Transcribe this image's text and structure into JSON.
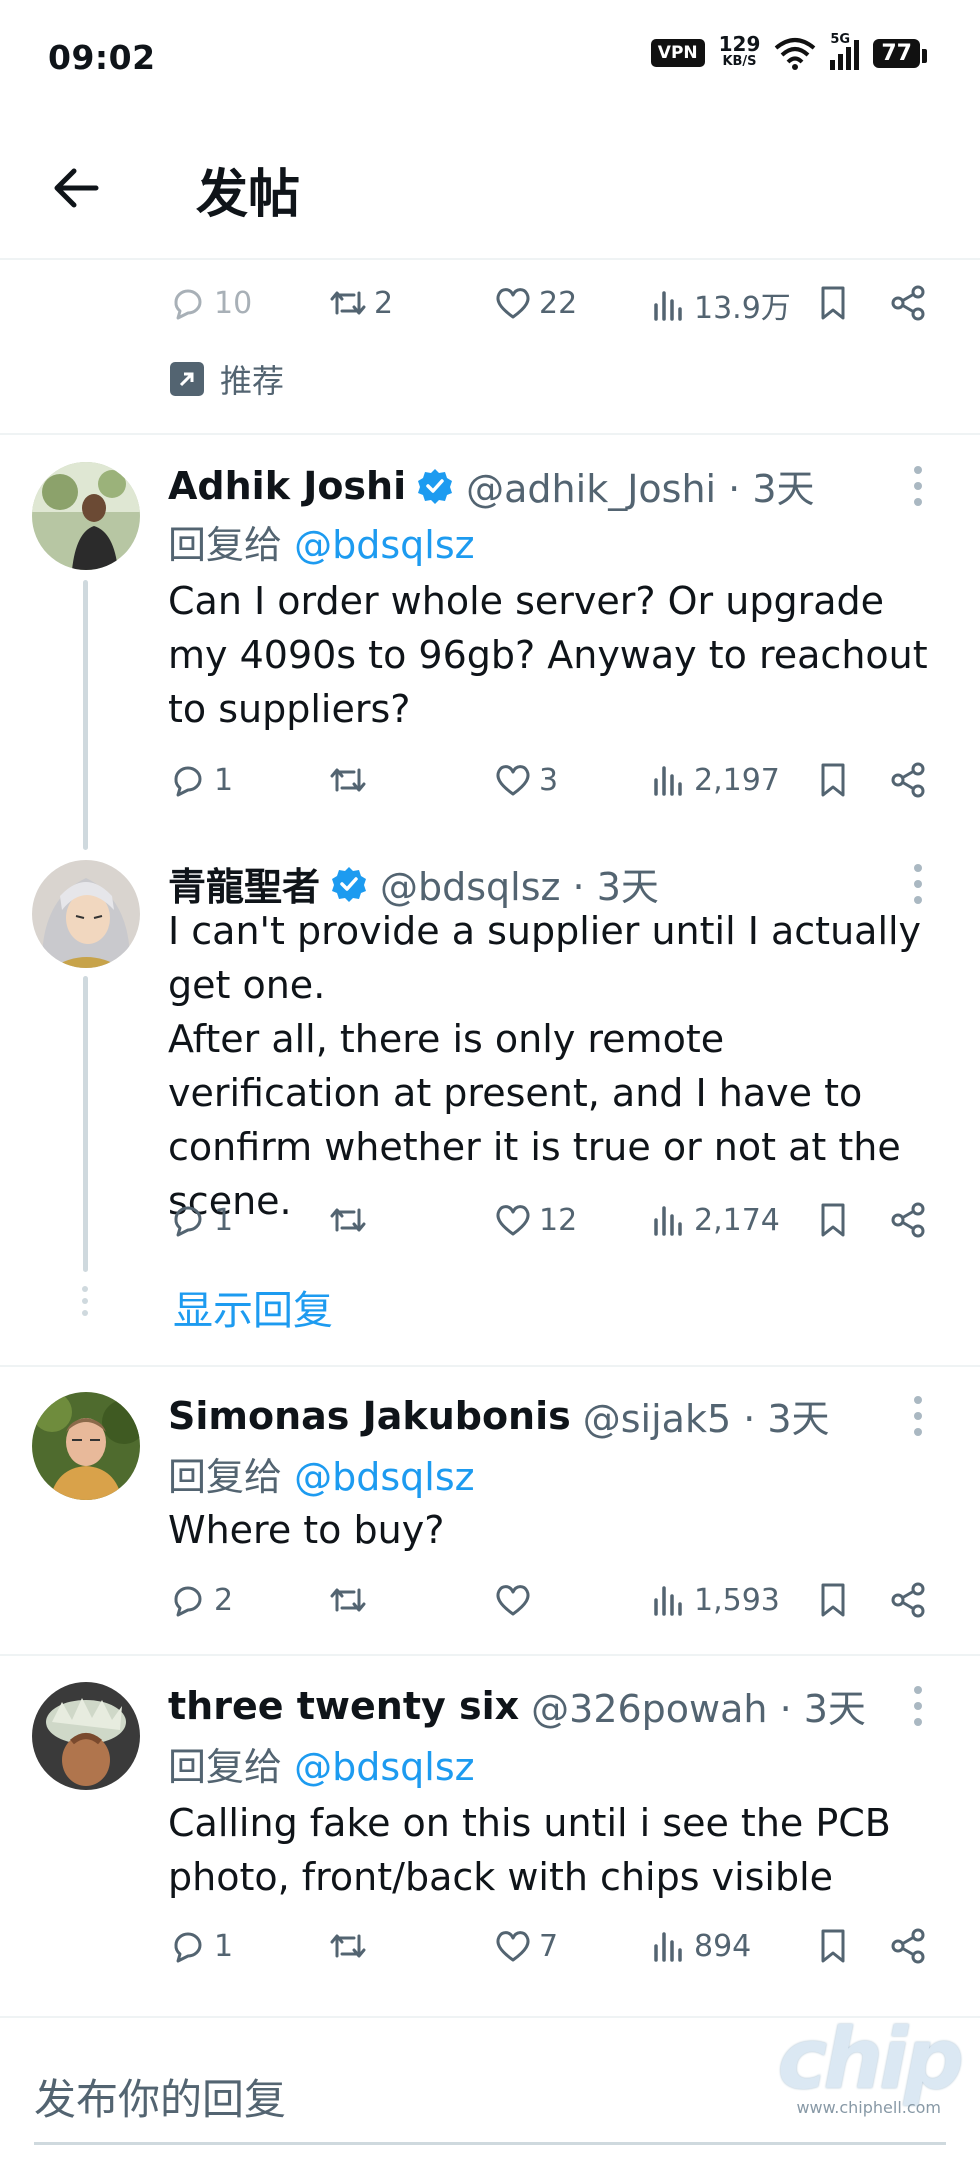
{
  "status_bar": {
    "time": "09:02",
    "vpn": "VPN",
    "speed_value": "129",
    "speed_unit": "KB/S",
    "network": "5G",
    "battery": "77"
  },
  "header": {
    "title": "发帖"
  },
  "top_actions": {
    "replies": "10",
    "reposts": "2",
    "likes": "22",
    "views": "13.9万"
  },
  "recommend": {
    "label": "推荐"
  },
  "tweets": [
    {
      "name": "Adhik Joshi",
      "handle": "@adhik_Joshi · 3天",
      "reply_prefix": "回复给 ",
      "reply_to": "@bdsqlsz",
      "text": "Can I order whole server? Or upgrade my 4090s to 96gb? Anyway to reachout to suppliers?",
      "replies": "1",
      "reposts": "",
      "likes": "3",
      "views": "2,197"
    },
    {
      "name": "青龍聖者",
      "handle": "@bdsqlsz · 3天",
      "text": "I can't provide a supplier until I actually get one.\nAfter all, there is only remote verification at present, and I have to confirm whether it is true or not at the scene.",
      "replies": "1",
      "reposts": "",
      "likes": "12",
      "views": "2,174"
    },
    {
      "name": "Simonas Jakubonis",
      "handle": "@sijak5 · 3天",
      "reply_prefix": "回复给 ",
      "reply_to": "@bdsqlsz",
      "text": "Where to buy?",
      "replies": "2",
      "reposts": "",
      "likes": "",
      "views": "1,593"
    },
    {
      "name": "three twenty six",
      "handle": "@326powah · 3天",
      "reply_prefix": "回复给 ",
      "reply_to": "@bdsqlsz",
      "text": "Calling fake on this until i see the PCB photo, front/back with chips visible",
      "replies": "1",
      "reposts": "",
      "likes": "7",
      "views": "894"
    }
  ],
  "show_replies": "显示回复",
  "reply_box": {
    "placeholder": "发布你的回复"
  },
  "watermark": {
    "big": "chip",
    "small": "www.chiphell.com"
  },
  "colors": {
    "accent": "#1d9bf0",
    "muted": "#536471",
    "divider": "#eff3f4"
  }
}
